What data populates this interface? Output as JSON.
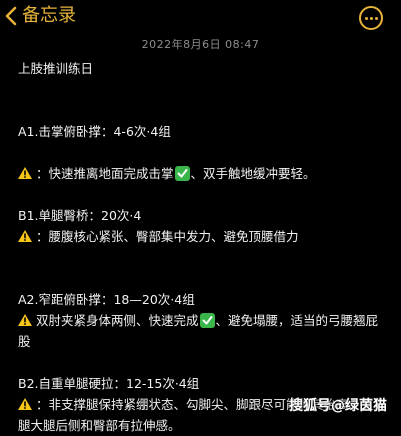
{
  "header": {
    "back_label": "备忘录",
    "back_icon": "chevron-left-icon",
    "more_icon": "more-circle-icon",
    "accent_color": "#e6b33a"
  },
  "note": {
    "timestamp": "2022年8月6日 08:47",
    "title": "上肢推训练日",
    "a1": {
      "heading": "A1.击掌俯卧撑：4-6次·4组",
      "tip_part1": "：快速推离地面完成击掌",
      "tip_part2": "、双手触地缓冲要轻。"
    },
    "b1": {
      "heading": "B1.单腿臀桥：20次·4",
      "tip": "：腰腹核心紧张、臀部集中发力、避免顶腰借力"
    },
    "a2": {
      "heading": "A2.窄距俯卧撑：18—20次·4组",
      "tip_part1": "双肘夹紧身体两侧、快速完成",
      "tip_part2": "、避免塌腰，适当的弓腰翘屁股"
    },
    "b2": {
      "heading": "B2.自重单腿硬拉：12-15次·4组",
      "tip": "：非支撑腿保持紧绷状态、勾脚尖、脚跟尽可能将其抬高、支撑腿大腿后侧和臀部有拉伸感。"
    }
  },
  "watermark": "搜狐号@绿茵猫"
}
